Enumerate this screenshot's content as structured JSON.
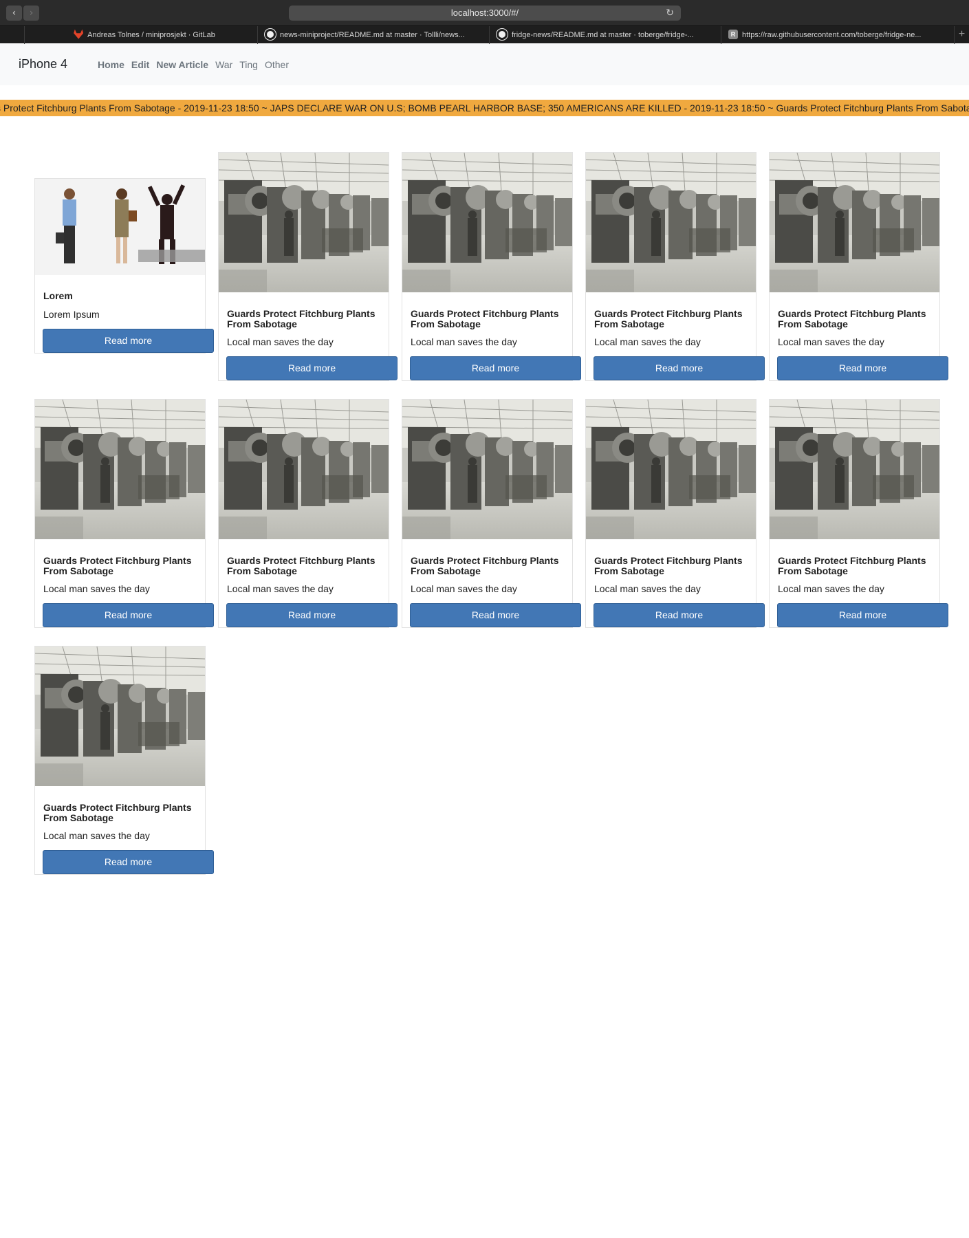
{
  "browser": {
    "url": "localhost:3000/#/",
    "tabs": [
      {
        "title": "Andreas Tolnes / miniprosjekt · GitLab",
        "icon": "gitlab-icon"
      },
      {
        "title": "news-miniproject/README.md at master · Tollli/news...",
        "icon": "github-icon"
      },
      {
        "title": "fridge-news/README.md at master · toberge/fridge-...",
        "icon": "github-icon"
      },
      {
        "title": "https://raw.githubusercontent.com/toberge/fridge-ne...",
        "icon": "raw-icon"
      }
    ]
  },
  "navbar": {
    "brand": "iPhone 4",
    "links": [
      "Home",
      "Edit",
      "New Article",
      "War",
      "Ting",
      "Other"
    ]
  },
  "ticker": {
    "text": "s Protect Fitchburg Plants From Sabotage - 2019-11-23 18:50 ~ JAPS DECLARE WAR ON U.S; BOMB PEARL HARBOR BASE; 350 AMERICANS ARE KILLED - 2019-11-23 18:50 ~ Guards Protect Fitchburg Plants From Sabotage",
    "color": "#f0a93f"
  },
  "cards": [
    {
      "title": "Lorem",
      "text": "Lorem Ipsum",
      "button": "Read more",
      "image": "people-handshake-photo"
    },
    {
      "title": "Guards Protect Fitchburg Plants From Sabotage",
      "text": "Local man saves the day",
      "button": "Read more",
      "image": "factory-photo"
    },
    {
      "title": "Guards Protect Fitchburg Plants From Sabotage",
      "text": "Local man saves the day",
      "button": "Read more",
      "image": "factory-photo"
    },
    {
      "title": "Guards Protect Fitchburg Plants From Sabotage",
      "text": "Local man saves the day",
      "button": "Read more",
      "image": "factory-photo"
    },
    {
      "title": "Guards Protect Fitchburg Plants From Sabotage",
      "text": "Local man saves the day",
      "button": "Read more",
      "image": "factory-photo"
    },
    {
      "title": "Guards Protect Fitchburg Plants From Sabotage",
      "text": "Local man saves the day",
      "button": "Read more",
      "image": "factory-photo"
    },
    {
      "title": "Guards Protect Fitchburg Plants From Sabotage",
      "text": "Local man saves the day",
      "button": "Read more",
      "image": "factory-photo"
    },
    {
      "title": "Guards Protect Fitchburg Plants From Sabotage",
      "text": "Local man saves the day",
      "button": "Read more",
      "image": "factory-photo"
    },
    {
      "title": "Guards Protect Fitchburg Plants From Sabotage",
      "text": "Local man saves the day",
      "button": "Read more",
      "image": "factory-photo"
    },
    {
      "title": "Guards Protect Fitchburg Plants From Sabotage",
      "text": "Local man saves the day",
      "button": "Read more",
      "image": "factory-photo"
    },
    {
      "title": "Guards Protect Fitchburg Plants From Sabotage",
      "text": "Local man saves the day",
      "button": "Read more",
      "image": "factory-photo"
    }
  ],
  "colors": {
    "button": "#4277b5",
    "ticker": "#f0a93f",
    "navbar": "#f8f9fa"
  }
}
